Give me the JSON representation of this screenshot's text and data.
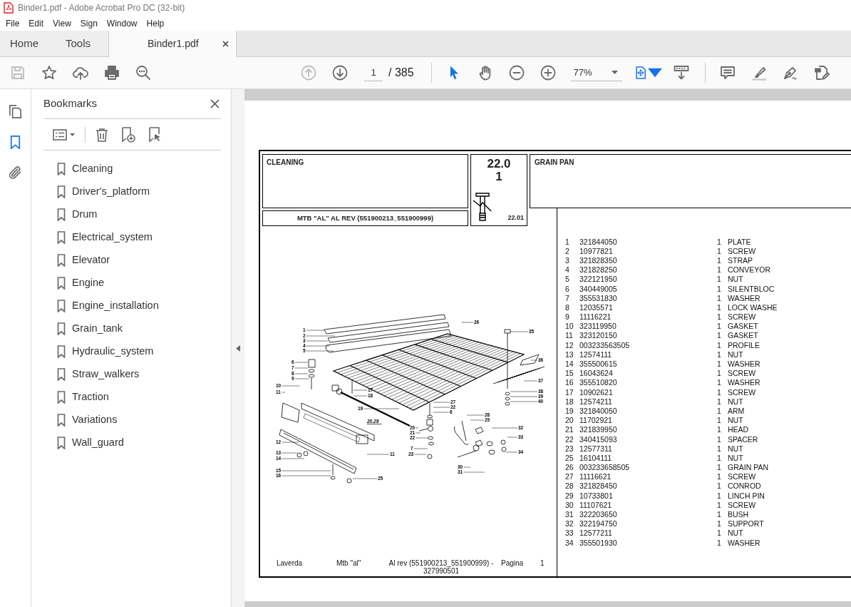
{
  "window": {
    "title": "Binder1.pdf - Adobe Acrobat Pro DC (32-bit)"
  },
  "menu": [
    "File",
    "Edit",
    "View",
    "Sign",
    "Window",
    "Help"
  ],
  "tabs": [
    {
      "label": "Home",
      "selected": false
    },
    {
      "label": "Tools",
      "selected": false
    },
    {
      "label": "Binder1.pdf",
      "selected": true
    }
  ],
  "toolbar": {
    "file_tools": [
      {
        "kind": "save",
        "disabled": true
      },
      {
        "kind": "star",
        "disabled": false
      },
      {
        "kind": "upload",
        "disabled": false
      },
      {
        "kind": "print",
        "disabled": false
      },
      {
        "kind": "find",
        "disabled": false
      }
    ],
    "page_nav": [
      {
        "kind": "previous",
        "disabled": true
      },
      {
        "kind": "next",
        "disabled": false
      }
    ],
    "page_number": "1",
    "page_count": "/ 385",
    "pointer_tools": [
      {
        "kind": "select",
        "selected": true
      },
      {
        "kind": "hand",
        "selected": false
      }
    ],
    "zoom_tools": [
      {
        "kind": "zoom_out"
      },
      {
        "kind": "zoom_in"
      }
    ],
    "zoom": "77%",
    "view_tools": [
      {
        "kind": "fit_page"
      },
      {
        "kind": "scroll_mode"
      }
    ],
    "comment_tools": [
      {
        "kind": "comment"
      },
      {
        "kind": "highlight"
      },
      {
        "kind": "sign"
      },
      {
        "kind": "edit"
      }
    ]
  },
  "rail": [
    {
      "kind": "pages",
      "selected": false
    },
    {
      "kind": "bookmarks",
      "selected": true
    },
    {
      "kind": "attachments",
      "selected": false
    }
  ],
  "bookmarks": {
    "title": "Bookmarks",
    "items": [
      "Cleaning",
      "Driver's_platform",
      "Drum",
      "Electrical_system",
      "Elevator",
      "Engine",
      "Engine_installation",
      "Grain_tank",
      "Hydraulic_system",
      "Straw_walkers",
      "Traction",
      "Variations",
      "Wall_guard"
    ]
  },
  "page": {
    "section": "CLEANING",
    "model": "MTB \"AL\"  AL REV (551900213_551900999)",
    "table_number": "22.01",
    "table_ref": "22.01",
    "group": "GRAIN PAN",
    "callouts": [
      "1",
      "2",
      "3",
      "4",
      "5",
      "6",
      "7",
      "8",
      "9",
      "10",
      "11",
      "17",
      "18",
      "19",
      "20.29",
      "11",
      "12",
      "13",
      "14",
      "15",
      "16",
      "25",
      "26",
      "27",
      "22",
      "6",
      "20",
      "21",
      "22",
      "7",
      "23",
      "28",
      "29",
      "32",
      "33",
      "34",
      "30",
      "31",
      "35",
      "36",
      "37",
      "38",
      "39",
      "40"
    ],
    "parts": [
      {
        "num": "1",
        "code": "321844050",
        "qty": "1",
        "desc": "PLATE"
      },
      {
        "num": "2",
        "code": "10977821",
        "qty": "1",
        "desc": "SCREW"
      },
      {
        "num": "3",
        "code": "321828350",
        "qty": "1",
        "desc": "STRAP"
      },
      {
        "num": "4",
        "code": "321828250",
        "qty": "1",
        "desc": "CONVEYOR"
      },
      {
        "num": "5",
        "code": "322121950",
        "qty": "1",
        "desc": "NUT"
      },
      {
        "num": "6",
        "code": "340449005",
        "qty": "1",
        "desc": "SILENTBLOC"
      },
      {
        "num": "7",
        "code": "355531830",
        "qty": "1",
        "desc": "WASHER"
      },
      {
        "num": "8",
        "code": "12035571",
        "qty": "1",
        "desc": "LOCK WASHE"
      },
      {
        "num": "9",
        "code": "11116221",
        "qty": "1",
        "desc": "SCREW"
      },
      {
        "num": "10",
        "code": "323119950",
        "qty": "1",
        "desc": "GASKET"
      },
      {
        "num": "11",
        "code": "323120150",
        "qty": "1",
        "desc": "GASKET"
      },
      {
        "num": "12",
        "code": "003233563505",
        "qty": "1",
        "desc": "PROFILE"
      },
      {
        "num": "13",
        "code": "12574111",
        "qty": "1",
        "desc": "NUT"
      },
      {
        "num": "14",
        "code": "355500615",
        "qty": "1",
        "desc": "WASHER"
      },
      {
        "num": "15",
        "code": "16043624",
        "qty": "1",
        "desc": "SCREW"
      },
      {
        "num": "16",
        "code": "355510820",
        "qty": "1",
        "desc": "WASHER"
      },
      {
        "num": "17",
        "code": "10902621",
        "qty": "1",
        "desc": "SCREW"
      },
      {
        "num": "18",
        "code": "12574211",
        "qty": "1",
        "desc": "NUT"
      },
      {
        "num": "19",
        "code": "321840050",
        "qty": "1",
        "desc": "ARM"
      },
      {
        "num": "20",
        "code": "11702921",
        "qty": "1",
        "desc": "NUT"
      },
      {
        "num": "21",
        "code": "321839950",
        "qty": "1",
        "desc": "HEAD"
      },
      {
        "num": "22",
        "code": "340415093",
        "qty": "1",
        "desc": "SPACER"
      },
      {
        "num": "23",
        "code": "12577311",
        "qty": "1",
        "desc": "NUT"
      },
      {
        "num": "25",
        "code": "16104111",
        "qty": "1",
        "desc": "NUT"
      },
      {
        "num": "26",
        "code": "003233658505",
        "qty": "1",
        "desc": "GRAIN PAN"
      },
      {
        "num": "27",
        "code": "11116621",
        "qty": "1",
        "desc": "SCREW"
      },
      {
        "num": "28",
        "code": "321828450",
        "qty": "1",
        "desc": "CONROD"
      },
      {
        "num": "29",
        "code": "10733801",
        "qty": "1",
        "desc": "LINCH PIN"
      },
      {
        "num": "30",
        "code": "11107621",
        "qty": "1",
        "desc": "SCREW"
      },
      {
        "num": "31",
        "code": "322203650",
        "qty": "1",
        "desc": "BUSH"
      },
      {
        "num": "32",
        "code": "322194750",
        "qty": "1",
        "desc": "SUPPORT"
      },
      {
        "num": "33",
        "code": "12577211",
        "qty": "1",
        "desc": "NUT"
      },
      {
        "num": "34",
        "code": "355501930",
        "qty": "1",
        "desc": "WASHER"
      }
    ],
    "footer": {
      "maker": "Laverda",
      "model": "Mtb \"al\"",
      "revision": "Al rev (551900213_551900999) - 327990501",
      "page_label": "Pagina",
      "page_number": "1"
    }
  }
}
